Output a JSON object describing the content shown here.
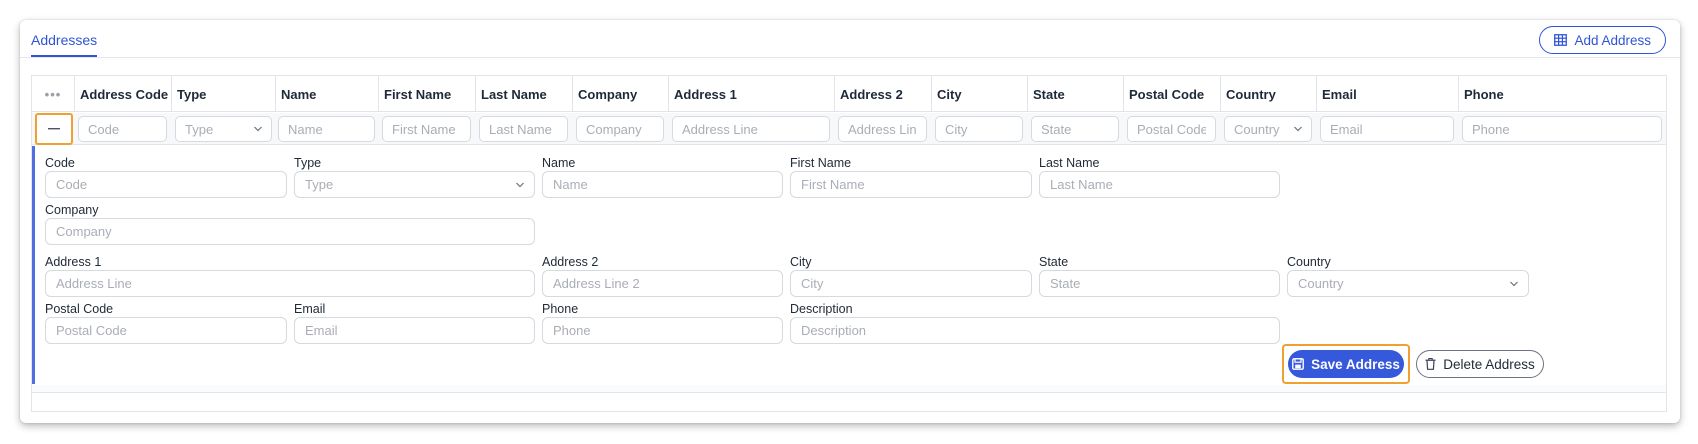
{
  "tabs": {
    "active": "Addresses"
  },
  "toolbar": {
    "add_label": "Add Address",
    "add_icon": "table-icon"
  },
  "grid": {
    "menu_icon": "•••",
    "columns": [
      "Address Code",
      "Type",
      "Name",
      "First Name",
      "Last Name",
      "Company",
      "Address 1",
      "Address 2",
      "City",
      "State",
      "Postal Code",
      "Country",
      "Email",
      "Phone"
    ],
    "filters": {
      "code": "Code",
      "type": "Type",
      "name": "Name",
      "first_name": "First Name",
      "last_name": "Last Name",
      "company": "Company",
      "address1": "Address Line",
      "address2": "Address Lin...",
      "city": "City",
      "state": "State",
      "postal": "Postal Code",
      "country": "Country",
      "email": "Email",
      "phone": "Phone"
    }
  },
  "form": {
    "code": {
      "label": "Code",
      "placeholder": "Code"
    },
    "type": {
      "label": "Type",
      "placeholder": "Type"
    },
    "name": {
      "label": "Name",
      "placeholder": "Name"
    },
    "first_name": {
      "label": "First Name",
      "placeholder": "First Name"
    },
    "last_name": {
      "label": "Last Name",
      "placeholder": "Last Name"
    },
    "company": {
      "label": "Company",
      "placeholder": "Company"
    },
    "address1": {
      "label": "Address 1",
      "placeholder": "Address Line"
    },
    "address2": {
      "label": "Address 2",
      "placeholder": "Address Line 2"
    },
    "city": {
      "label": "City",
      "placeholder": "City"
    },
    "state": {
      "label": "State",
      "placeholder": "State"
    },
    "country": {
      "label": "Country",
      "placeholder": "Country"
    },
    "postal": {
      "label": "Postal Code",
      "placeholder": "Postal Code"
    },
    "email": {
      "label": "Email",
      "placeholder": "Email"
    },
    "phone": {
      "label": "Phone",
      "placeholder": "Phone"
    },
    "description": {
      "label": "Description",
      "placeholder": "Description"
    }
  },
  "actions": {
    "save_label": "Save Address",
    "delete_label": "Delete Address"
  },
  "colors": {
    "accent": "#2f55d4",
    "highlight": "#f0a030",
    "detail_border": "#4f6fe3"
  }
}
